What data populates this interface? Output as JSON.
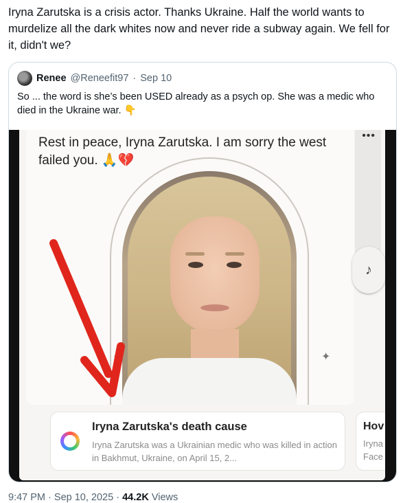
{
  "tweet": {
    "text": "Iryna Zarutska is a crisis actor. Thanks Ukraine. Half the world wants to murdelize all the dark whites now and never ride a subway again. We fell for it, didn't we?"
  },
  "quote": {
    "name": "Renee",
    "handle": "@Reneefit97",
    "separator": "·",
    "date": "Sep 10",
    "text": "So ... the word is she’s been USED already as a psych op. She was a medic who died in the Ukraine war.",
    "emoji": "👇"
  },
  "media": {
    "caption": "Rest in peace, Iryna Zarutska. I am sorry the west failed you.",
    "caption_emoji": "🙏💔",
    "more_icon": "•••",
    "music_icon": "♪",
    "result_card": {
      "title": "Iryna Zarutska's death cause",
      "body": "Iryna Zarutska was a Ukrainian medic who was killed in action in Bakhmut, Ukraine, on April 15, 2..."
    },
    "result_card_2": {
      "title": "Hov",
      "line1": "Iryna",
      "line2": "Face"
    }
  },
  "footer": {
    "time": "9:47 PM",
    "date": "Sep 10, 2025",
    "separator": "·",
    "views_count": "44.2K",
    "views_label": "Views"
  },
  "colors": {
    "text": "#0f1419",
    "secondary": "#536471",
    "border": "#cfd9de",
    "arrow": "#e0261c"
  }
}
